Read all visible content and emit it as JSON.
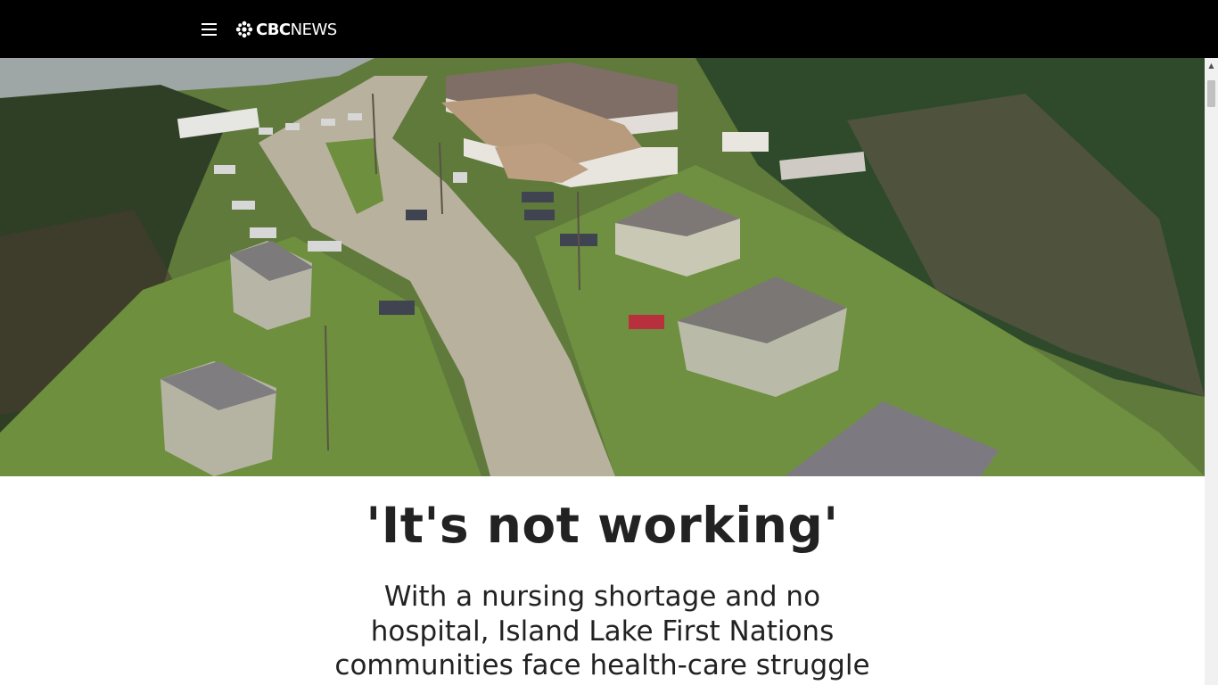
{
  "header": {
    "brand_primary": "CBC",
    "brand_secondary": "NEWS",
    "menu_icon": "hamburger-menu-icon",
    "logo_icon": "cbc-gem-icon",
    "background": "#000000"
  },
  "hero": {
    "image": "aerial-photo-of-houses-along-dirt-road-in-forest"
  },
  "article": {
    "headline": "'It's not working'",
    "subheadline": "With a nursing shortage and no hospital, Island Lake First Nations communities face health-care struggle"
  },
  "scrollbar": {
    "up_icon": "scroll-up-arrow-icon"
  },
  "colors": {
    "text": "#222222",
    "header_bg": "#000000",
    "page_bg": "#ffffff"
  }
}
